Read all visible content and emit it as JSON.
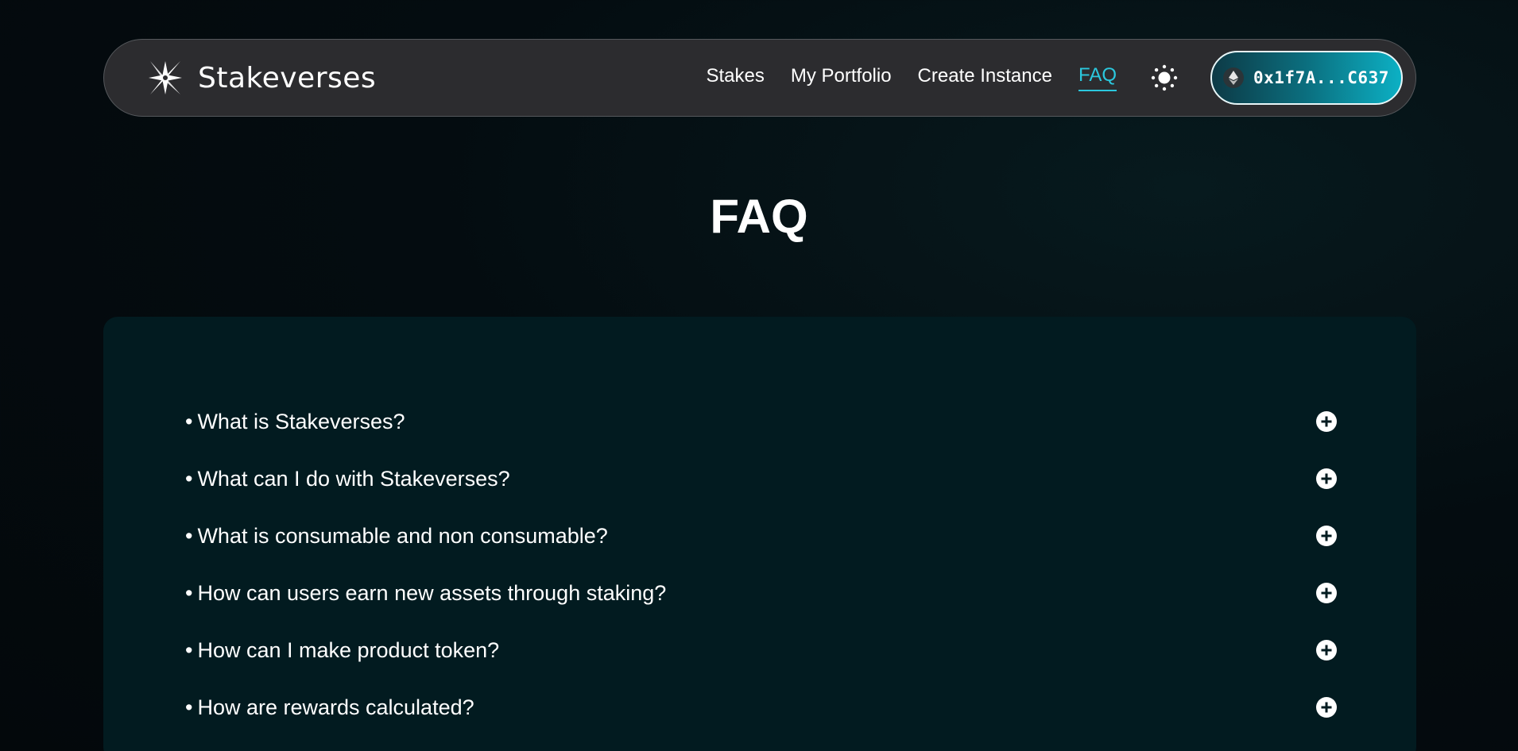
{
  "brand": {
    "name": "Stakeverses",
    "logo_icon": "sparkle-star-logo"
  },
  "nav": {
    "links": [
      {
        "label": "Stakes",
        "active": false
      },
      {
        "label": "My Portfolio",
        "active": false
      },
      {
        "label": "Create Instance",
        "active": false
      },
      {
        "label": "FAQ",
        "active": true
      }
    ],
    "theme_icon": "sun-icon",
    "wallet": {
      "network_icon": "ethereum-icon",
      "address": "0x1f7A...C637"
    }
  },
  "page": {
    "title": "FAQ"
  },
  "faq": {
    "bullet": "•",
    "expand_icon": "plus-circle-icon",
    "items": [
      {
        "question": "What is Stakeverses?"
      },
      {
        "question": "What can I do with Stakeverses?"
      },
      {
        "question": "What is consumable and non consumable?"
      },
      {
        "question": "How can users earn new assets through staking?"
      },
      {
        "question": "How can I make product token?"
      },
      {
        "question": "How are rewards calculated?"
      }
    ]
  },
  "colors": {
    "accent": "#2bc8de",
    "navbar_bg": "#2c2c2f",
    "panel_bg": "#021b20",
    "page_bg": "#03080b"
  }
}
